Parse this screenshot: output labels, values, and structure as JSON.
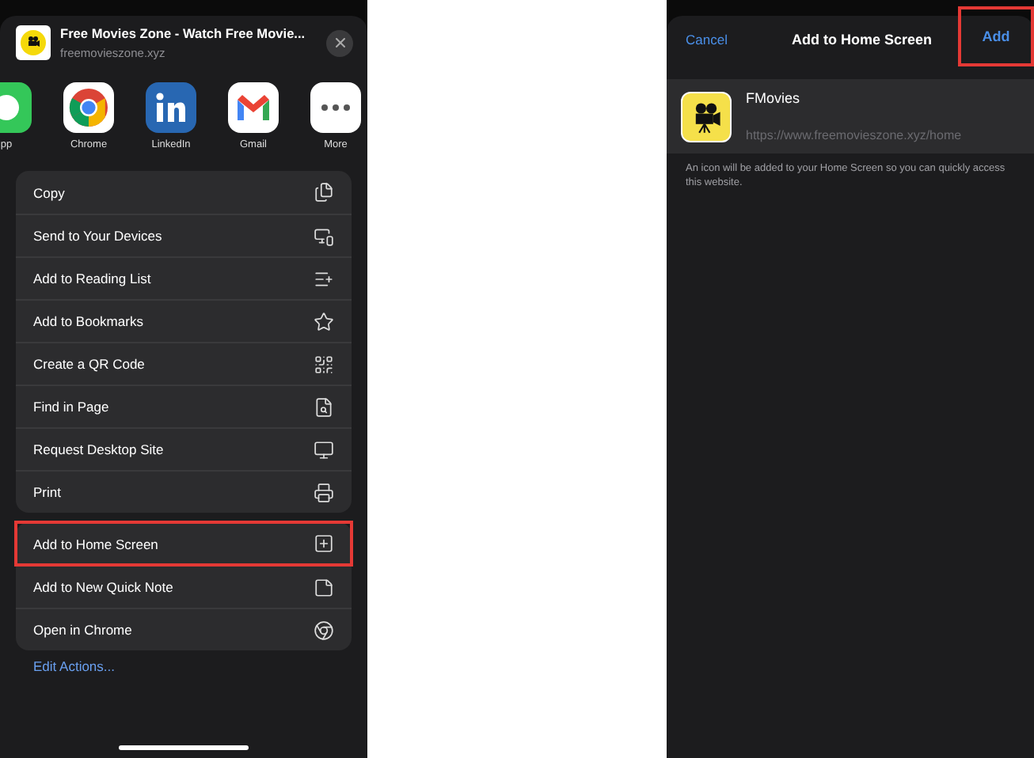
{
  "share_sheet": {
    "title": "Free Movies Zone - Watch Free Movie...",
    "url": "freemovieszone.xyz",
    "apps": [
      {
        "label": "pp"
      },
      {
        "label": "Chrome"
      },
      {
        "label": "LinkedIn"
      },
      {
        "label": "Gmail"
      },
      {
        "label": "More"
      }
    ],
    "action_groups": [
      [
        {
          "label": "Copy",
          "highlighted": false
        },
        {
          "label": "Send to Your Devices",
          "highlighted": false
        },
        {
          "label": "Add to Reading List",
          "highlighted": false
        },
        {
          "label": "Add to Bookmarks",
          "highlighted": false
        },
        {
          "label": "Create a QR Code",
          "highlighted": false
        },
        {
          "label": "Find in Page",
          "highlighted": false
        },
        {
          "label": "Request Desktop Site",
          "highlighted": false
        },
        {
          "label": "Print",
          "highlighted": false
        }
      ],
      [
        {
          "label": "Add to Home Screen",
          "highlighted": true
        },
        {
          "label": "Add to New Quick Note",
          "highlighted": false
        },
        {
          "label": "Open in Chrome",
          "highlighted": false
        }
      ]
    ],
    "edit_actions": "Edit Actions..."
  },
  "add_to_home": {
    "cancel": "Cancel",
    "title": "Add to Home Screen",
    "add": "Add",
    "add_highlighted": true,
    "name": "FMovies",
    "url": "https://www.freemovieszone.xyz/home",
    "note": "An icon will be added to your Home Screen so you can quickly access this website."
  }
}
